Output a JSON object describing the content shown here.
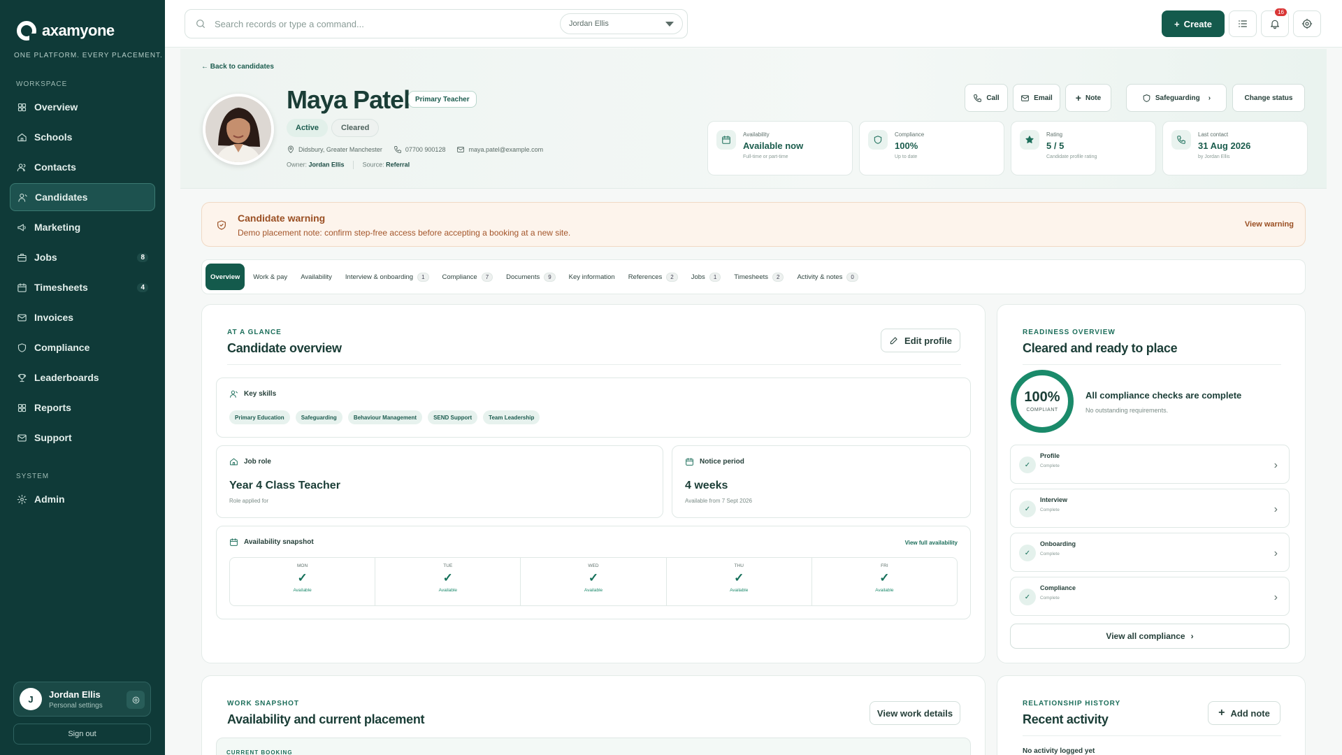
{
  "app": {
    "brand": "axamyone",
    "tagline": "ONE PLATFORM. EVERY PLACEMENT."
  },
  "sidebar": {
    "workspace_label": "WORKSPACE",
    "system_label": "SYSTEM",
    "items": [
      {
        "label": "Overview",
        "icon": "grid-icon"
      },
      {
        "label": "Schools",
        "icon": "home-icon"
      },
      {
        "label": "Contacts",
        "icon": "users-icon"
      },
      {
        "label": "Candidates",
        "icon": "user-icon",
        "active": true
      },
      {
        "label": "Marketing",
        "icon": "megaphone-icon"
      },
      {
        "label": "Jobs",
        "icon": "briefcase-icon",
        "badge": "8"
      },
      {
        "label": "Timesheets",
        "icon": "calendar-icon",
        "badge": "4"
      },
      {
        "label": "Invoices",
        "icon": "mail-icon"
      },
      {
        "label": "Compliance",
        "icon": "shield-icon"
      },
      {
        "label": "Leaderboards",
        "icon": "trophy-icon"
      },
      {
        "label": "Reports",
        "icon": "grid-icon"
      },
      {
        "label": "Support",
        "icon": "mail-icon"
      }
    ],
    "admin": {
      "label": "Admin",
      "icon": "gear-icon"
    },
    "user": {
      "initial": "J",
      "name": "Jordan Ellis",
      "sub": "Personal settings"
    },
    "signout": "Sign out"
  },
  "topbar": {
    "search_placeholder": "Search records or type a command...",
    "owner_select": "Jordan Ellis",
    "create_label": "Create",
    "notif_count": "16"
  },
  "candidate": {
    "back": "← Back to candidates",
    "name": "Maya Patel",
    "role_tag": "Primary Teacher",
    "status_active": "Active",
    "status_cleared": "Cleared",
    "location": "Didsbury, Greater Manchester",
    "phone": "07700 900128",
    "email": "maya.patel@example.com",
    "owner_label": "Owner:",
    "owner": "Jordan Ellis",
    "source_label": "Source:",
    "source": "Referral",
    "actions": {
      "call": "Call",
      "email": "Email",
      "note": "Note",
      "safeguarding": "Safeguarding",
      "change_status": "Change status"
    },
    "stats": [
      {
        "label": "Availability",
        "value": "Available now",
        "sub": "Full-time or part-time"
      },
      {
        "label": "Compliance",
        "value": "100%",
        "sub": "Up to date"
      },
      {
        "label": "Rating",
        "value": "5 / 5",
        "sub": "Candidate profile rating"
      },
      {
        "label": "Last contact",
        "value": "31 Aug 2026",
        "sub": "by Jordan Ellis"
      }
    ]
  },
  "warning": {
    "title": "Candidate warning",
    "text": "Demo placement note: confirm step-free access before accepting a booking at a new site.",
    "link": "View warning"
  },
  "tabs": [
    {
      "label": "Overview",
      "active": true
    },
    {
      "label": "Work & pay"
    },
    {
      "label": "Availability"
    },
    {
      "label": "Interview & onboarding",
      "count": "1"
    },
    {
      "label": "Compliance",
      "count": "7"
    },
    {
      "label": "Documents",
      "count": "9"
    },
    {
      "label": "Key information"
    },
    {
      "label": "References",
      "count": "2"
    },
    {
      "label": "Jobs",
      "count": "1"
    },
    {
      "label": "Timesheets",
      "count": "2"
    },
    {
      "label": "Activity & notes",
      "count": "0"
    }
  ],
  "overview": {
    "eyebrow": "AT A GLANCE",
    "title": "Candidate overview",
    "edit_btn": "Edit profile",
    "skills_label": "Key skills",
    "skills": [
      "Primary Education",
      "Safeguarding",
      "Behaviour Management",
      "SEND Support",
      "Team Leadership"
    ],
    "job_role_label": "Job role",
    "job_role": "Year 4 Class Teacher",
    "job_role_sub": "Role applied for",
    "notice_label": "Notice period",
    "notice": "4 weeks",
    "notice_sub": "Available from 7 Sept 2026",
    "avail_label": "Availability snapshot",
    "avail_link": "View full availability",
    "days": [
      {
        "day": "MON",
        "status": "Available"
      },
      {
        "day": "TUE",
        "status": "Available"
      },
      {
        "day": "WED",
        "status": "Available"
      },
      {
        "day": "THU",
        "status": "Available"
      },
      {
        "day": "FRI",
        "status": "Available"
      }
    ]
  },
  "readiness": {
    "eyebrow": "READINESS OVERVIEW",
    "title": "Cleared and ready to place",
    "percent": "100%",
    "percent_value": 100,
    "percent_label": "COMPLIANT",
    "summary_title": "All compliance checks are complete",
    "summary_sub": "No outstanding requirements.",
    "checks": [
      {
        "title": "Profile",
        "status": "Complete"
      },
      {
        "title": "Interview",
        "status": "Complete"
      },
      {
        "title": "Onboarding",
        "status": "Complete"
      },
      {
        "title": "Compliance",
        "status": "Complete"
      }
    ],
    "view_all": "View all compliance"
  },
  "work": {
    "eyebrow": "WORK SNAPSHOT",
    "title": "Availability and current placement",
    "btn": "View work details",
    "current_booking": "CURRENT BOOKING"
  },
  "relationship": {
    "eyebrow": "RELATIONSHIP HISTORY",
    "title": "Recent activity",
    "btn": "Add note",
    "empty": "No activity logged yet"
  },
  "colors": {
    "sidebar": "#0f3a38",
    "accent": "#145a4c",
    "warning_bg": "#fdf4ec"
  }
}
